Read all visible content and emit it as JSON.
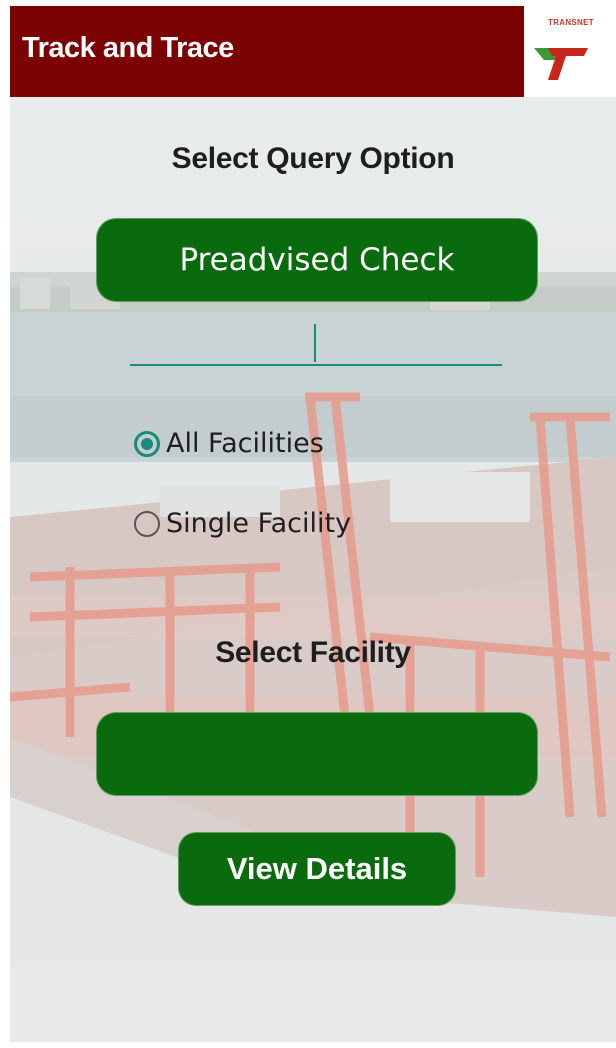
{
  "app": {
    "title": "Track and Trace",
    "brand_text": "TRANSNET"
  },
  "query": {
    "heading": "Select Query Option",
    "selected_option": "Preadvised Check",
    "input_value": ""
  },
  "scope": {
    "options": [
      {
        "label": "All Facilities",
        "checked": true
      },
      {
        "label": "Single Facility",
        "checked": false
      }
    ]
  },
  "facility": {
    "heading": "Select Facility",
    "selected": ""
  },
  "actions": {
    "view_label": "View Details"
  },
  "colors": {
    "header": "#7b0303",
    "button": "#0a6b0e",
    "accent": "#1a8a7a"
  }
}
